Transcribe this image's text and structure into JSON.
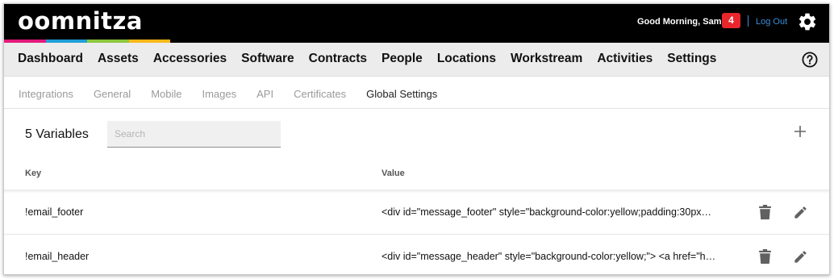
{
  "brand": {
    "logo_text": "oomnitza",
    "strip_colors": [
      "#e3197c",
      "#1e9fd8",
      "#8cc63e",
      "#f9b817"
    ]
  },
  "header": {
    "greeting": "Good Morning, Sam!",
    "notification_count": "4",
    "logout_label": "Log Out",
    "settings_icon": "gear-icon"
  },
  "main_nav": {
    "items": [
      {
        "label": "Dashboard"
      },
      {
        "label": "Assets"
      },
      {
        "label": "Accessories"
      },
      {
        "label": "Software"
      },
      {
        "label": "Contracts"
      },
      {
        "label": "People"
      },
      {
        "label": "Locations"
      },
      {
        "label": "Workstream"
      },
      {
        "label": "Activities"
      },
      {
        "label": "Settings"
      }
    ],
    "help_icon": "help-icon"
  },
  "sub_nav": {
    "items": [
      {
        "label": "Integrations"
      },
      {
        "label": "General"
      },
      {
        "label": "Mobile"
      },
      {
        "label": "Images"
      },
      {
        "label": "API"
      },
      {
        "label": "Certificates"
      },
      {
        "label": "Global Settings"
      }
    ],
    "active": "Global Settings"
  },
  "variables": {
    "title": "5 Variables",
    "search_placeholder": "Search",
    "search_value": "",
    "add_icon": "plus-icon",
    "columns": {
      "key": "Key",
      "value": "Value"
    },
    "rows": [
      {
        "key": "!email_footer",
        "value": "<div id=\"message_footer\" style=\"background-color:yellow;padding:30px…"
      },
      {
        "key": "!email_header",
        "value": "<div id=\"message_header\" style=\"background-color:yellow;\"> <a href=\"h…"
      }
    ]
  },
  "colors": {
    "topbar": "#000000",
    "nav_bg": "#ececec",
    "badge": "#e8262c",
    "link": "#3a8fd6",
    "icon": "#616161"
  }
}
